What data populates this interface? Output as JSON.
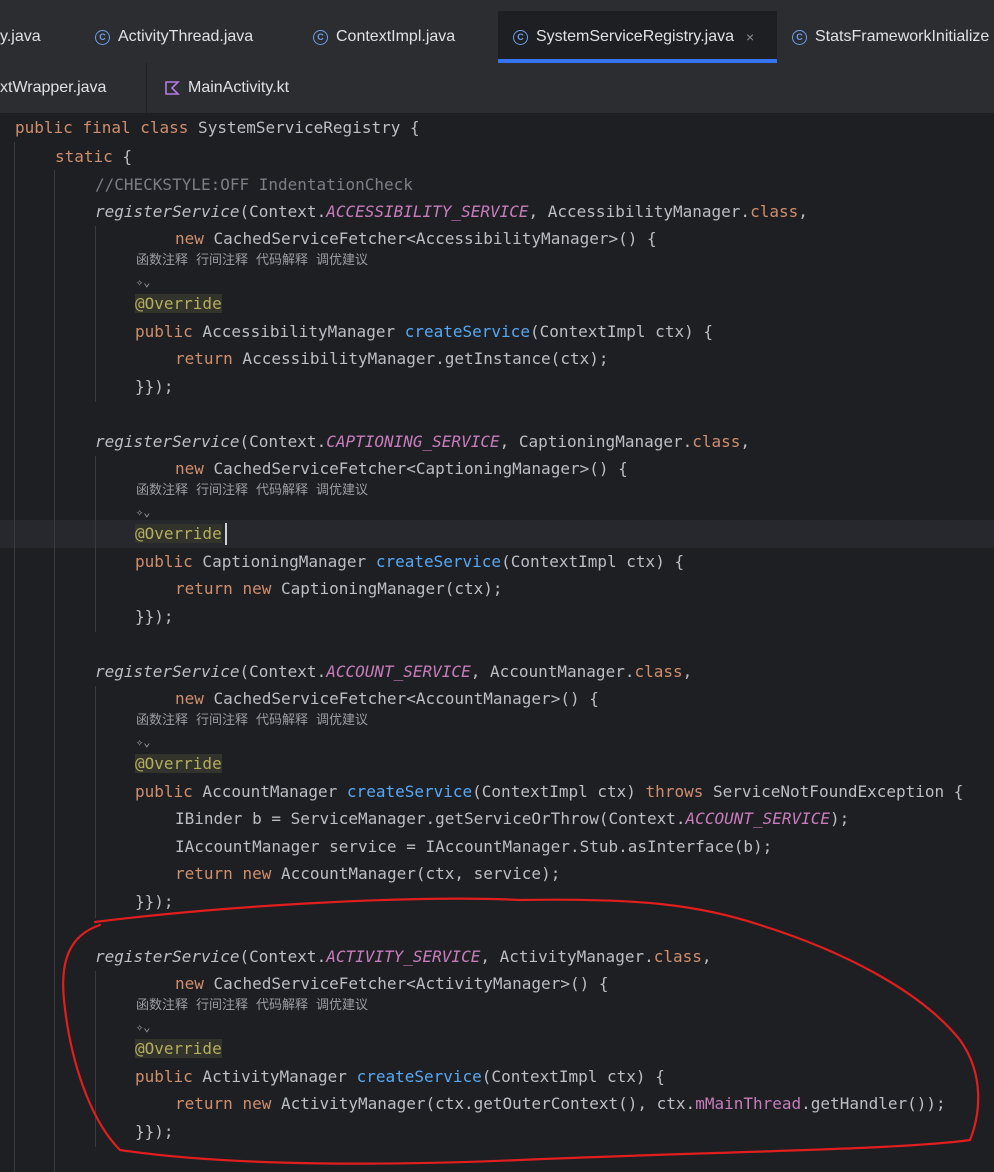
{
  "tabs_row1": [
    {
      "label": "y.java",
      "active": false
    },
    {
      "label": "ActivityThread.java",
      "active": false
    },
    {
      "label": "ContextImpl.java",
      "active": false
    },
    {
      "label": "SystemServiceRegistry.java",
      "active": true,
      "close": "×"
    },
    {
      "label": "StatsFrameworkInitialize",
      "active": false
    }
  ],
  "tabs_row2": [
    {
      "label": "xtWrapper.java"
    },
    {
      "label": "MainActivity.kt"
    }
  ],
  "hints": [
    "函数注释",
    "行间注释",
    "代码解释",
    "调优建议"
  ],
  "ai_icon": "✧⌄",
  "code": {
    "l1": {
      "kw1": "public",
      "kw2": "final",
      "kw3": "class",
      "rest": " SystemServiceRegistry {"
    },
    "l2": {
      "kw": "static",
      "rest": " {"
    },
    "l3": "//CHECKSTYLE:OFF IndentationCheck",
    "b1": {
      "reg": "registerService",
      "ctx": "(Context.",
      "cst": "ACCESSIBILITY_SERVICE",
      "mgr": ", AccessibilityManager.",
      "cls": "class",
      "end": ",",
      "new": "new",
      "fetcher": " CachedServiceFetcher<AccessibilityManager>() {",
      "ann": "@Override",
      "pub": "public",
      "type": " AccessibilityManager ",
      "fn": "createService",
      "params": "(ContextImpl ctx) {",
      "ret": "return",
      "retexpr": " AccessibilityManager.getInstance(ctx);",
      "close": "}});"
    },
    "b2": {
      "reg": "registerService",
      "ctx": "(Context.",
      "cst": "CAPTIONING_SERVICE",
      "mgr": ", CaptioningManager.",
      "cls": "class",
      "end": ",",
      "new": "new",
      "fetcher": " CachedServiceFetcher<CaptioningManager>() {",
      "ann": "@Override",
      "pub": "public",
      "type": " CaptioningManager ",
      "fn": "createService",
      "params": "(ContextImpl ctx) {",
      "ret": "return",
      "new2": "new",
      "retexpr": " CaptioningManager(ctx);",
      "close": "}});"
    },
    "b3": {
      "reg": "registerService",
      "ctx": "(Context.",
      "cst": "ACCOUNT_SERVICE",
      "mgr": ", AccountManager.",
      "cls": "class",
      "end": ",",
      "new": "new",
      "fetcher": " CachedServiceFetcher<AccountManager>() {",
      "ann": "@Override",
      "pub": "public",
      "type": " AccountManager ",
      "fn": "createService",
      "params": "(ContextImpl ctx) ",
      "throws": "throws",
      "exc": " ServiceNotFoundException {",
      "l1a": "IBinder b = ServiceManager.getServiceOrThrow(Context.",
      "l1cst": "ACCOUNT_SERVICE",
      "l1b": ");",
      "l2": "IAccountManager service = IAccountManager.Stub.asInterface(b);",
      "ret": "return",
      "new2": "new",
      "retexpr": " AccountManager(ctx, service);",
      "close": "}});"
    },
    "b4": {
      "reg": "registerService",
      "ctx": "(Context.",
      "cst": "ACTIVITY_SERVICE",
      "mgr": ", ActivityManager.",
      "cls": "class",
      "end": ",",
      "new": "new",
      "fetcher": " CachedServiceFetcher<ActivityManager>() {",
      "ann": "@Override",
      "pub": "public",
      "type": " ActivityManager ",
      "fn": "createService",
      "params": "(ContextImpl ctx) {",
      "ret": "return",
      "new2": "new",
      "retexpr1": " ActivityManager(ctx.getOuterContext(), ctx.",
      "fld": "mMainThread",
      "retexpr2": ".getHandler());",
      "close": "}});"
    }
  },
  "colors": {
    "accent": "#3574f0",
    "annotation": "#e01e1e"
  }
}
